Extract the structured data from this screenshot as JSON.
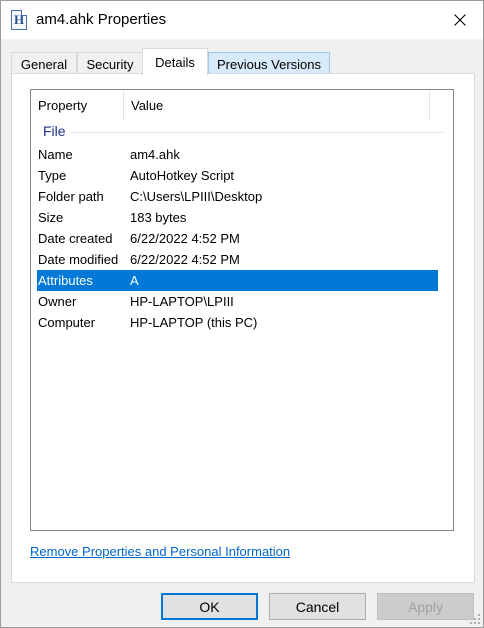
{
  "window": {
    "title": "am4.ahk Properties",
    "icon": "ahk-file-icon",
    "icon_letter": "H",
    "close": "close-icon"
  },
  "tabs": [
    {
      "label": "General",
      "active": false
    },
    {
      "label": "Security",
      "active": false
    },
    {
      "label": "Details",
      "active": true
    },
    {
      "label": "Previous Versions",
      "active": false,
      "hover": true
    }
  ],
  "details": {
    "columns": [
      "Property",
      "Value"
    ],
    "group": "File",
    "rows": [
      {
        "property": "Name",
        "value": "am4.ahk"
      },
      {
        "property": "Type",
        "value": "AutoHotkey Script"
      },
      {
        "property": "Folder path",
        "value": "C:\\Users\\LPIII\\Desktop"
      },
      {
        "property": "Size",
        "value": "183 bytes"
      },
      {
        "property": "Date created",
        "value": "6/22/2022 4:52 PM"
      },
      {
        "property": "Date modified",
        "value": "6/22/2022 4:52 PM"
      },
      {
        "property": "Attributes",
        "value": "A",
        "selected": true
      },
      {
        "property": "Owner",
        "value": "HP-LAPTOP\\LPIII"
      },
      {
        "property": "Computer",
        "value": "HP-LAPTOP (this PC)"
      }
    ]
  },
  "link": {
    "remove_properties": "Remove Properties and Personal Information"
  },
  "buttons": {
    "ok": "OK",
    "cancel": "Cancel",
    "apply": "Apply"
  },
  "colors": {
    "selection": "#0078d7",
    "link": "#0066cc",
    "group_header": "#1e3287"
  }
}
